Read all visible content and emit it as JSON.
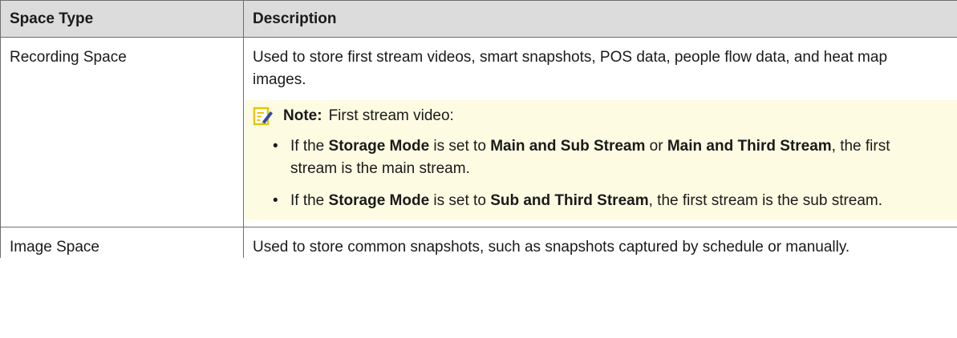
{
  "table": {
    "headers": [
      "Space Type",
      "Description"
    ],
    "rows": [
      {
        "type": "Recording Space",
        "description": "Used to store first stream videos, smart snapshots, POS data, people flow data, and heat map images.",
        "note": {
          "icon": "note-pencil-icon",
          "label": "Note:",
          "text": "First stream video:",
          "bullets": [
            {
              "t1": "If the ",
              "b1": "Storage Mode",
              "t2": " is set to ",
              "b2": "Main and Sub Stream",
              "t3": " or ",
              "b3": "Main and Third Stream",
              "t4": ", the first stream is the main stream."
            },
            {
              "t1": "If the ",
              "b1": "Storage Mode",
              "t2": " is set to ",
              "b2": "Sub and Third Stream",
              "t3": ", the first stream is the sub stream."
            }
          ]
        }
      },
      {
        "type": "Image Space",
        "description": "Used to store common snapshots, such as snapshots captured by schedule or manually."
      }
    ]
  },
  "colors": {
    "header_bg": "#dcdcdc",
    "note_bg": "#fdfbe2",
    "border": "#6e6e6e",
    "note_icon": "#e8c400"
  }
}
